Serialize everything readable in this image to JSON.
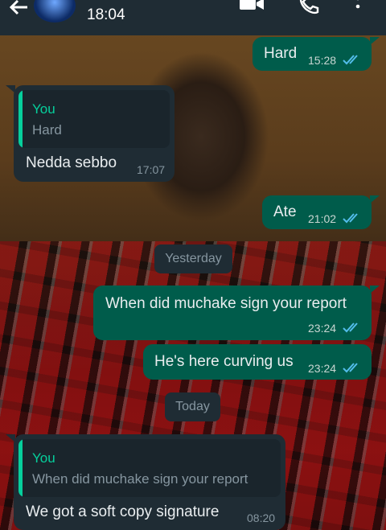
{
  "header": {
    "time": "18:04",
    "icons": [
      "back-arrow-icon",
      "avatar",
      "video-call-icon",
      "voice-call-icon",
      "more-options-icon"
    ]
  },
  "colors": {
    "outgoing": "#005c4b",
    "incoming": "#1f2c34",
    "accent": "#06cf9c",
    "read_ticks": "#53bdeb"
  },
  "messages": [
    {
      "dir": "out",
      "text": "Hard",
      "time": "15:28",
      "status": "read"
    },
    {
      "dir": "in",
      "reply_to": {
        "who": "You",
        "text": "Hard"
      },
      "text": "Nedda sebbo",
      "time": "17:07"
    },
    {
      "dir": "out",
      "text": "Ate",
      "time": "21:02",
      "status": "read"
    },
    {
      "dir": "out",
      "text": "When did muchake sign your report",
      "time": "23:24",
      "status": "read"
    },
    {
      "dir": "out",
      "text": "He's here curving us",
      "time": "23:24",
      "status": "read"
    },
    {
      "dir": "in",
      "reply_to": {
        "who": "You",
        "text": "When did muchake sign your report"
      },
      "text": "We got a soft copy signature",
      "time": "08:20"
    }
  ],
  "date_chips": {
    "yesterday": "Yesterday",
    "today": "Today"
  }
}
